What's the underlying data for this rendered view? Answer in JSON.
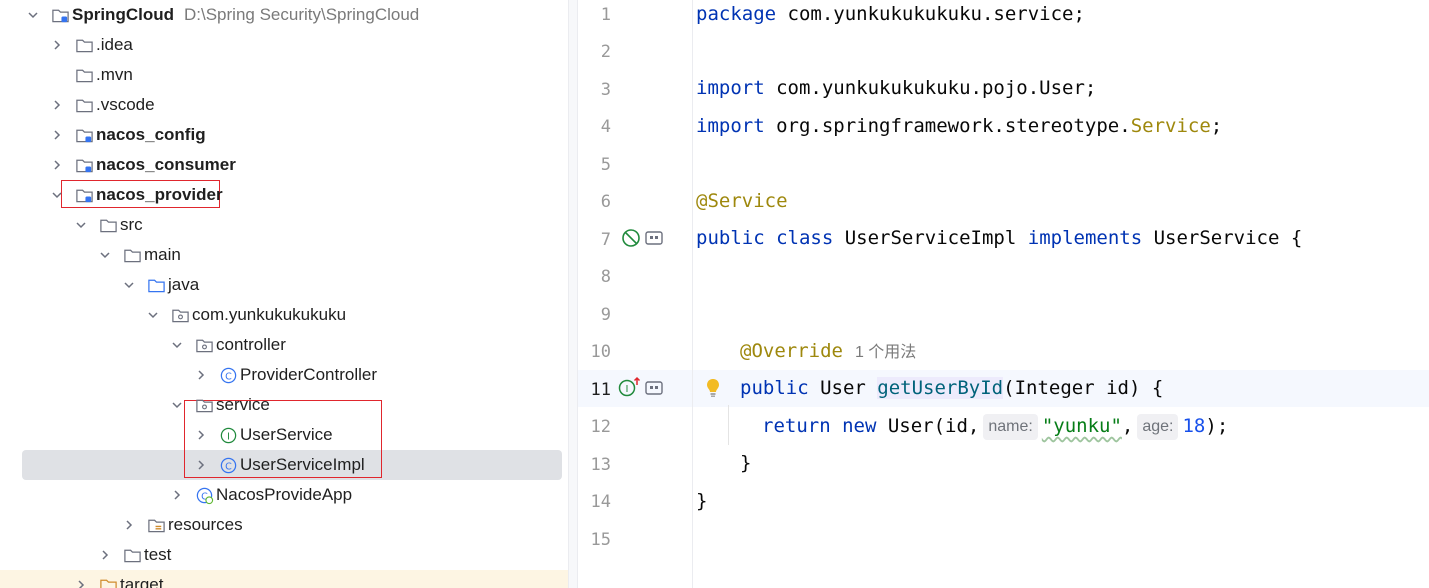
{
  "project_tree": {
    "root": {
      "name": "SpringCloud",
      "path": "D:\\Spring Security\\SpringCloud"
    },
    "items": [
      {
        "label": ".idea"
      },
      {
        "label": ".mvn"
      },
      {
        "label": ".vscode"
      },
      {
        "label": "nacos_config"
      },
      {
        "label": "nacos_consumer"
      },
      {
        "label": "nacos_provider"
      },
      {
        "label": "src"
      },
      {
        "label": "main"
      },
      {
        "label": "java"
      },
      {
        "label": "com.yunkukukukuku"
      },
      {
        "label": "controller"
      },
      {
        "label": "ProviderController"
      },
      {
        "label": "service"
      },
      {
        "label": "UserService"
      },
      {
        "label": "UserServiceImpl"
      },
      {
        "label": "NacosProvideApp"
      },
      {
        "label": "resources"
      },
      {
        "label": "test"
      },
      {
        "label": "target"
      }
    ]
  },
  "editor": {
    "line_numbers": [
      "1",
      "2",
      "3",
      "4",
      "5",
      "6",
      "7",
      "8",
      "9",
      "10",
      "11",
      "12",
      "13",
      "14",
      "15"
    ],
    "current_line": "11",
    "code": {
      "l1_kw": "package",
      "l1_rest": " com.yunkukukukuku.service;",
      "l3_kw": "import",
      "l3_rest": " com.yunkukukukuku.pojo.User;",
      "l4_kw": "import",
      "l4_rest": " org.springframework.stereotype.",
      "l4_cls": "Service",
      "l4_end": ";",
      "l6_ann": "@Service",
      "l7_kw1": "public class",
      "l7_name": " UserServiceImpl ",
      "l7_kw2": "implements",
      "l7_rest": " UserService {",
      "l10_ann": "@Override",
      "l10_usages": "1 个用法",
      "l11_kw": "public",
      "l11_type": " User ",
      "l11_meth": "getUserById",
      "l11_rest": "(Integer id) {",
      "l12_kw": "return new",
      "l12_a": " User(id,",
      "l12_hint1": "name:",
      "l12_str": "\"yunku\"",
      "l12_b": ",",
      "l12_hint2": "age:",
      "l12_num": "18",
      "l12_end": ");",
      "l13": "}",
      "l14": "}"
    }
  },
  "colors": {
    "keyword": "#0033b3",
    "annotation": "#9e880d",
    "string": "#067d17",
    "number": "#1750eb",
    "method": "#00627a",
    "highlight_box": "#e0262d",
    "selection": "#dfe1e5"
  }
}
